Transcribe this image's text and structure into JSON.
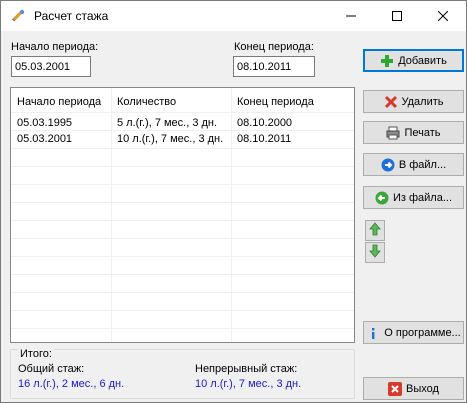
{
  "window": {
    "title": "Расчет стажа"
  },
  "period": {
    "start_label": "Начало периода:",
    "start_value": "05.03.2001",
    "end_label": "Конец периода:",
    "end_value": "08.10.2011"
  },
  "buttons": {
    "add": "Добавить",
    "delete": "Удалить",
    "print": "Печать",
    "to_file": "В файл...",
    "from_file": "Из файла...",
    "about": "О программе...",
    "exit": "Выход"
  },
  "table": {
    "headers": [
      "Начало периода",
      "Количество",
      "Конец периода"
    ],
    "rows": [
      [
        "05.03.1995",
        "5 л.(г.), 7 мес., 3 дн.",
        "08.10.2000"
      ],
      [
        "05.03.2001",
        "10 л.(г.), 7 мес., 3 дн.",
        "08.10.2011"
      ]
    ]
  },
  "totals": {
    "title": "Итого:",
    "total_label": "Общий стаж:",
    "total_value": "16 л.(г.), 2 мес., 6 дн.",
    "continuous_label": "Непрерывный стаж:",
    "continuous_value": "10 л.(г.), 7 мес., 3 дн."
  },
  "colors": {
    "result_text": "#1a1acc",
    "add_icon": "#2fa82f",
    "delete_icon": "#d63a2a",
    "exit_icon": "#d63a2a",
    "file_icon": "#1e6fd9",
    "from_file_icon": "#3aa63a",
    "arrow_icon": "#5cb85c"
  },
  "icons": {
    "app": "tools-icon",
    "add": "plus-icon",
    "delete": "x-icon",
    "print": "printer-icon",
    "to_file": "arrow-right-circle-icon",
    "from_file": "arrow-left-circle-icon",
    "move_up": "arrow-up-icon",
    "move_down": "arrow-down-icon",
    "about": "info-icon",
    "exit": "exit-icon"
  }
}
